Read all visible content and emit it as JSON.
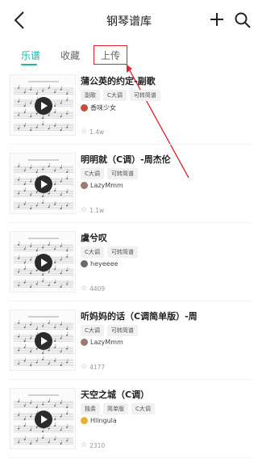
{
  "header": {
    "title": "钢琴谱库",
    "back_icon": "chevron-left-icon",
    "add_icon": "plus-icon",
    "search_icon": "search-icon"
  },
  "tabs": [
    {
      "label": "乐谱",
      "active": true
    },
    {
      "label": "收藏",
      "active": false
    },
    {
      "label": "上传",
      "active": false
    }
  ],
  "colors": {
    "accent": "#1fb5a5",
    "annotation": "#e1242d"
  },
  "items": [
    {
      "title": "蒲公英的约定-副歌",
      "tags": [
        "副歌",
        "C大调",
        "可转简谱"
      ],
      "author": "香味少女",
      "avatar_color": "#c0503a",
      "stars": "1.4w"
    },
    {
      "title": "明明就（C调）-周杰伦",
      "tags": [
        "C大调",
        "可转简谱"
      ],
      "author": "LazyMmm",
      "avatar_color": "#9a7b6c",
      "stars": "1.1w"
    },
    {
      "title": "虞兮叹",
      "tags": [
        "C大调",
        "可转简谱"
      ],
      "author": "heyeeee",
      "avatar_color": "#6b6b6b",
      "stars": "4409"
    },
    {
      "title": "听妈妈的话（C调简单版）-周",
      "tags": [
        "C大调",
        "可转简谱"
      ],
      "author": "LazyMmm",
      "avatar_color": "#9a7b6c",
      "stars": "4177"
    },
    {
      "title": "天空之城（C调）",
      "tags": [
        "独奏",
        "简单版",
        "C大调"
      ],
      "author": "Hlingula",
      "avatar_color": "#e3b23c",
      "stars": "2310"
    }
  ]
}
